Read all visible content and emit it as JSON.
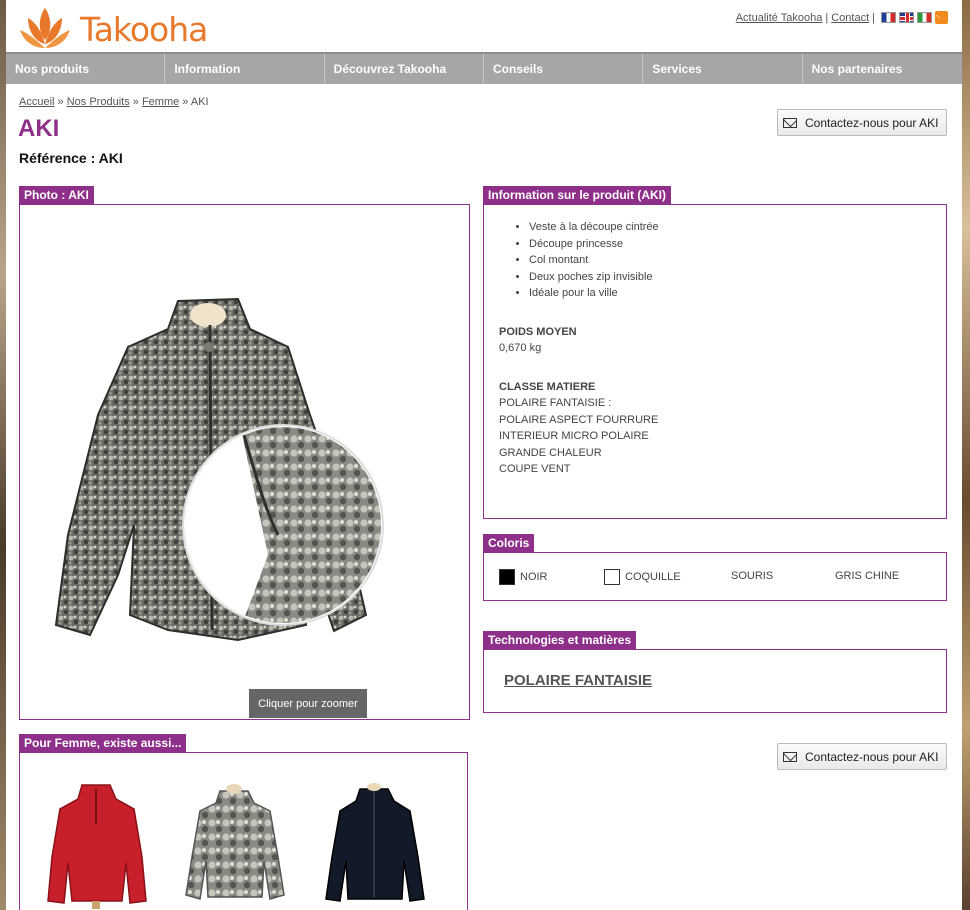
{
  "header": {
    "logo_text": "Takooha",
    "links": [
      "Actualité Takooha",
      "Contact"
    ],
    "separator": "|"
  },
  "nav": {
    "items": [
      "Nos produits",
      "Information",
      "Découvrez Takooha",
      "Conseils",
      "Services",
      "Nos partenaires"
    ]
  },
  "breadcrumb": {
    "items": [
      "Accueil",
      "Nos Produits",
      "Femme"
    ],
    "current": "AKI",
    "separator": "»"
  },
  "product": {
    "title": "AKI",
    "reference": "Référence : AKI"
  },
  "buttons": {
    "contact": "Contactez-nous pour AKI",
    "zoom": "Cliquer pour zoomer"
  },
  "photo": {
    "label": "Photo : AKI"
  },
  "info": {
    "label": "Information sur le produit (AKI)",
    "features": [
      "Veste à la découpe cintrée",
      "Découpe princesse",
      "Col montant",
      "Deux poches zip invisible",
      "Idéale pour la ville"
    ],
    "weight_heading": "POIDS MOYEN",
    "weight_value": "0,670 kg",
    "material_heading": "CLASSE MATIERE",
    "material_lines": [
      "POLAIRE FANTAISIE :",
      "POLAIRE ASPECT FOURRURE",
      "INTERIEUR MICRO POLAIRE",
      "GRANDE CHALEUR",
      "COUPE VENT"
    ]
  },
  "colors": {
    "label": "Coloris",
    "items": [
      {
        "name": "NOIR",
        "swatch": "#000000"
      },
      {
        "name": "COQUILLE",
        "swatch": "#ffffff"
      },
      {
        "name": "SOURIS",
        "swatch": ""
      },
      {
        "name": "GRIS CHINE",
        "swatch": ""
      }
    ]
  },
  "technologies": {
    "label": "Technologies et matières",
    "link": "POLAIRE FANTAISIE"
  },
  "also": {
    "label": "Pour Femme, existe aussi..."
  },
  "theme": {
    "accent": "#8e2f8a",
    "nav_bg": "#a6a6a6",
    "logo_orange": "#e8792b"
  }
}
